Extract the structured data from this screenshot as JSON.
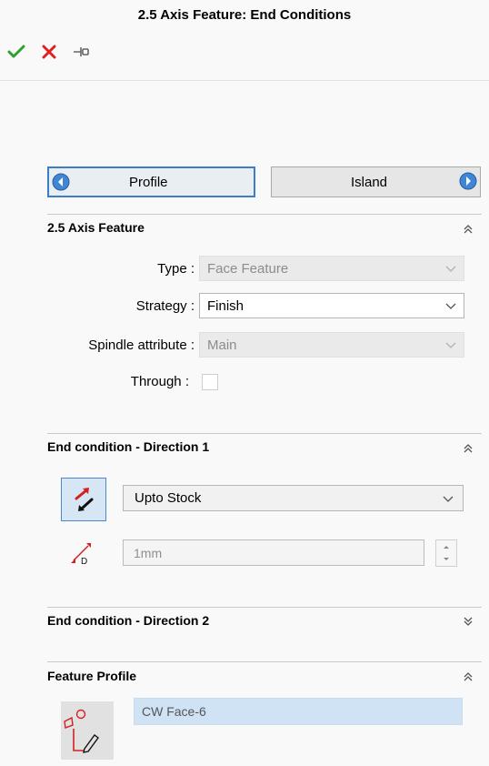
{
  "header": {
    "title": "2.5 Axis Feature: End Conditions"
  },
  "actions": {
    "ok": "checkmark-icon",
    "cancel": "close-icon",
    "pin": "pin-icon"
  },
  "tabs": {
    "left_label": "Profile",
    "right_label": "Island"
  },
  "section1": {
    "title": "2.5 Axis Feature",
    "type_label": "Type :",
    "type_value": "Face Feature",
    "strategy_label": "Strategy :",
    "strategy_value": "Finish",
    "spindle_label": "Spindle attribute :",
    "spindle_value": "Main",
    "through_label": "Through :",
    "through_checked": false
  },
  "section2": {
    "title": "End condition - Direction 1",
    "end_type": "Upto Stock",
    "depth": "1mm"
  },
  "section3": {
    "title": "End condition - Direction 2"
  },
  "section4": {
    "title": "Feature Profile",
    "items": [
      "CW Face-6"
    ]
  },
  "colors": {
    "accent": "#3a7dc8",
    "ok": "#2ea02e",
    "cancel": "#e02020",
    "selection": "#cfe3f5"
  }
}
